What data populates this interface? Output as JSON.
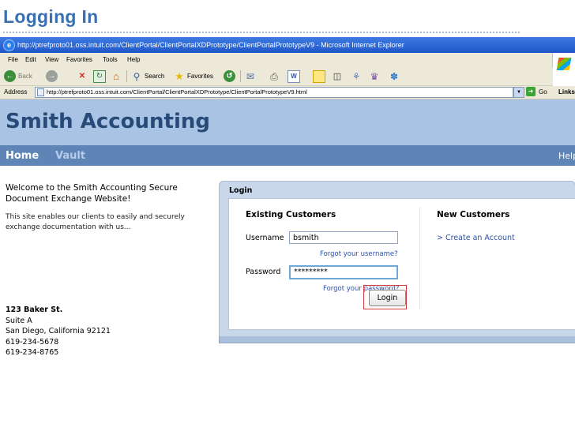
{
  "slide": {
    "title": "Logging In"
  },
  "browser": {
    "window_title": "http://ptrefproto01.oss.intuit.com/ClientPortal/ClientPortalXDPrototype/ClientPortalPrototypeV9 - Microsoft Internet Explorer",
    "menu": [
      "File",
      "Edit",
      "View",
      "Favorites",
      "Tools",
      "Help"
    ],
    "toolbar": {
      "back": "Back",
      "search": "Search",
      "favorites": "Favorites"
    },
    "address_label": "Address",
    "address_url": "http://ptrefproto01.oss.intuit.com/ClientPortal/ClientPortalXDPrototype/ClientPortalPrototypeV9.html",
    "go_label": "Go",
    "links_label": "Links"
  },
  "site": {
    "title": "Smith Accounting",
    "nav": {
      "home": "Home",
      "vault": "Vault",
      "help": "Help"
    },
    "welcome_line1": "Welcome to the Smith Accounting Secure",
    "welcome_line2": "Document Exchange Website!",
    "intro_line1": "This site enables our clients to easily and securely",
    "intro_line2": "exchange documentation with us...",
    "address_lines": [
      "123 Baker St.",
      "Suite A",
      "San Diego, California 92121",
      "619-234-5678",
      "619-234-8765"
    ]
  },
  "login": {
    "panel_title": "Login",
    "existing_title": "Existing Customers",
    "username_label": "Username",
    "username_value": "bsmith",
    "forgot_username": "Forgot your username?",
    "password_label": "Password",
    "password_value": "*********",
    "forgot_password": "Forgot your password?",
    "login_button": "Login",
    "new_title": "New Customers",
    "create_account": "> Create an Account"
  },
  "colors": {
    "slide_title": "#3a6fb0",
    "site_header": "#a8c3e3",
    "site_nav": "#5e85b6",
    "highlight": "#d43a3a"
  }
}
